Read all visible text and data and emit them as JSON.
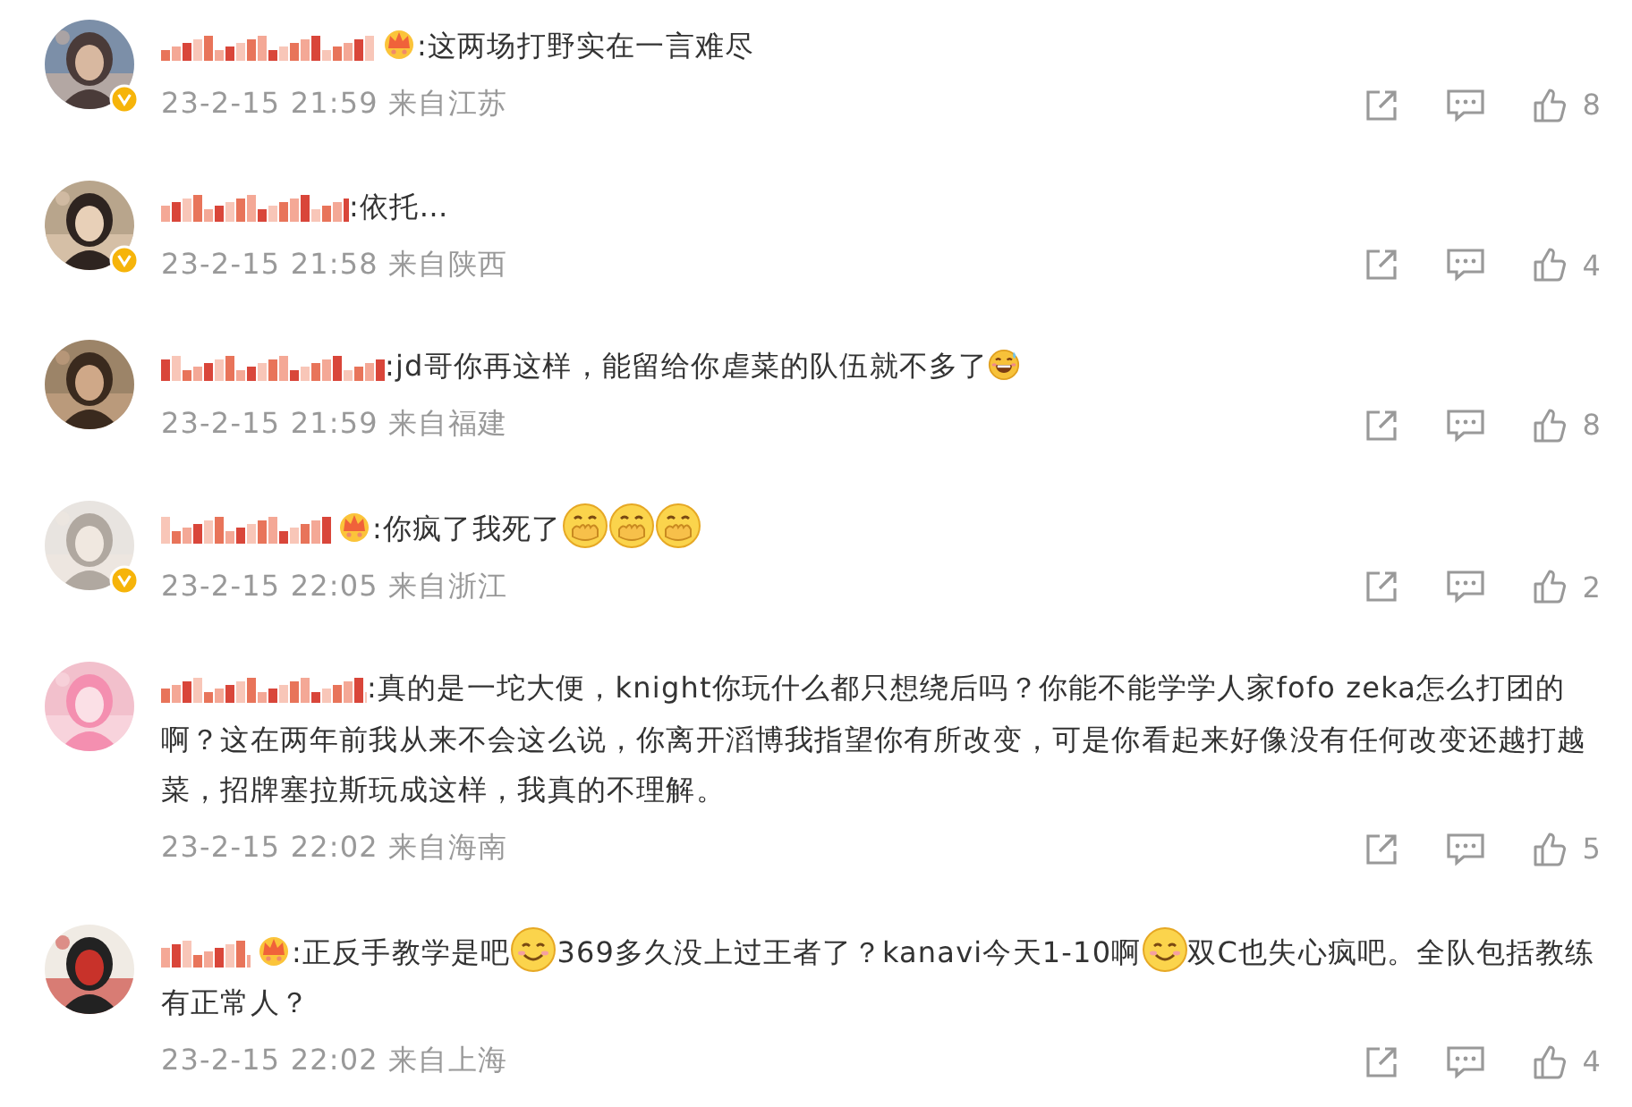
{
  "comments": [
    {
      "verified": true,
      "crown": true,
      "content": [
        {
          "kind": "text",
          "text": ":这两场打野实在一言难尽"
        }
      ],
      "time": "23-2-15 21:59 来自江苏",
      "like_count": "8"
    },
    {
      "verified": true,
      "crown": false,
      "content": [
        {
          "kind": "text",
          "text": ":依托…"
        }
      ],
      "time": "23-2-15 21:58 来自陕西",
      "like_count": "4"
    },
    {
      "verified": false,
      "crown": false,
      "content": [
        {
          "kind": "text",
          "text": ":jd哥你再这样，能留给你虐菜的队伍就不多了"
        },
        {
          "kind": "sweat-grin"
        }
      ],
      "time": "23-2-15 21:59 来自福建",
      "like_count": "8"
    },
    {
      "verified": true,
      "crown": true,
      "content": [
        {
          "kind": "text",
          "text": ":你疯了我死了"
        },
        {
          "kind": "hand-mouth"
        },
        {
          "kind": "hand-mouth"
        },
        {
          "kind": "hand-mouth"
        }
      ],
      "time": "23-2-15 22:05 来自浙江",
      "like_count": "2"
    },
    {
      "verified": false,
      "crown": false,
      "content": [
        {
          "kind": "text",
          "text": ":真的是一坨大便，knight你玩什么都只想绕后吗？你能不能学学人家fofo zeka怎么打团的啊？这在两年前我从来不会这么说，你离开滔博我指望你有所改变，可是你看起来好像没有任何改变还越打越菜，招牌塞拉斯玩成这样，我真的不理解。"
        }
      ],
      "time": "23-2-15 22:02 来自海南",
      "like_count": "5"
    },
    {
      "verified": false,
      "crown": true,
      "content": [
        {
          "kind": "text",
          "text": ":正反手教学是吧"
        },
        {
          "kind": "smile"
        },
        {
          "kind": "text",
          "text": "369多久没上过王者了？kanavi今天1-10啊"
        },
        {
          "kind": "smile"
        },
        {
          "kind": "text",
          "text": "双C也失心疯吧。全队包括教练有正常人？"
        }
      ],
      "time": "23-2-15 22:02 来自上海",
      "like_count": "4"
    }
  ]
}
